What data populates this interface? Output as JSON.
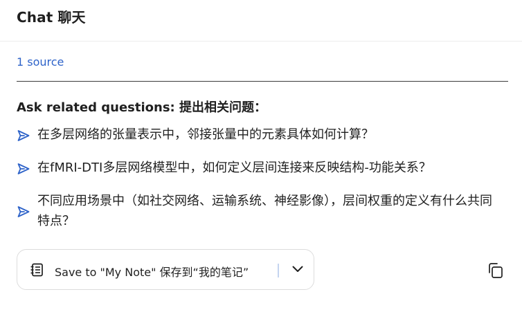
{
  "header": {
    "title": "Chat  聊天"
  },
  "sources": {
    "link_label": "1 source"
  },
  "related": {
    "heading": "Ask related questions:  提出相关问题：",
    "questions": [
      {
        "text": "在多层网络的张量表示中，邻接张量中的元素具体如何计算？",
        "icon": "send-arrow-icon"
      },
      {
        "text": "在fMRI-DTI多层网络模型中，如何定义层间连接来反映结构-功能关系？",
        "icon": "send-arrow-icon"
      },
      {
        "text": "不同应用场景中（如社交网络、运输系统、神经影像），层间权重的定义有什么共同特点？",
        "icon": "send-arrow-icon"
      }
    ]
  },
  "actions": {
    "save_label": "Save to \"My Note\"  保存到“我的笔记”",
    "save_icon": "note-icon",
    "dropdown_icon": "chevron-down-icon",
    "copy_icon": "copy-icon"
  },
  "colors": {
    "link": "#2e63c9",
    "accent": "#2e63c9",
    "text": "#1f1f1f"
  }
}
